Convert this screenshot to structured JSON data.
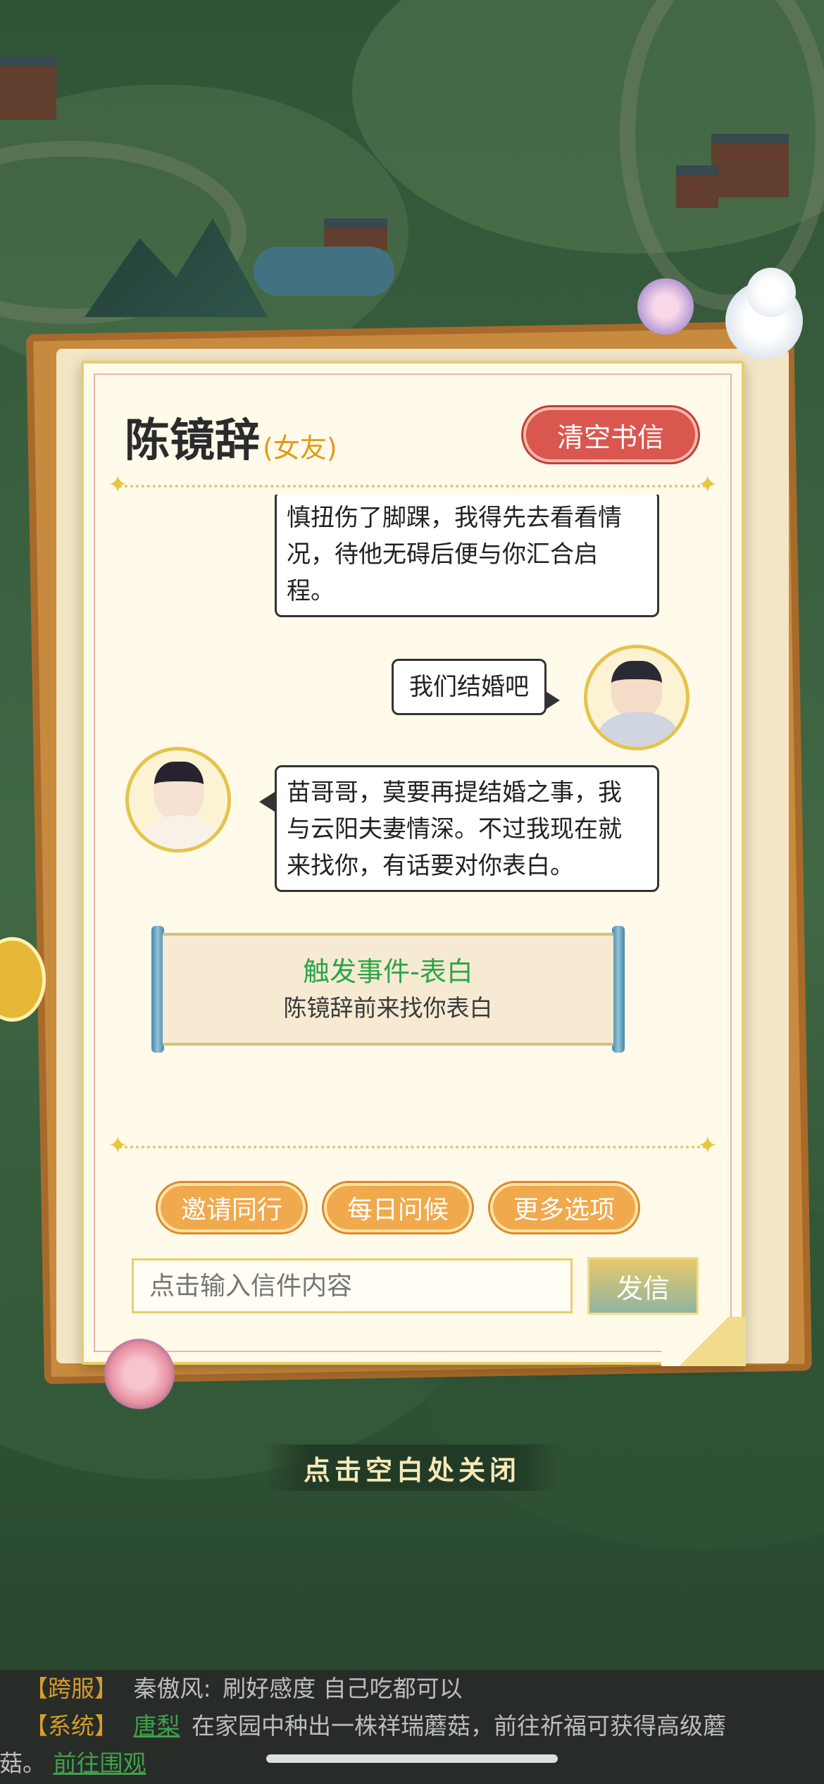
{
  "letter": {
    "name": "陈镜辞",
    "relation": "(女友)",
    "clear_label": "清空书信",
    "messages": [
      {
        "from": "her",
        "lines": [
          "慎扭伤了脚踝，我得先去看看情",
          "况，待他无碍后便与你汇合启",
          "程。"
        ]
      },
      {
        "from": "me",
        "lines": [
          "我们结婚吧"
        ]
      },
      {
        "from": "her",
        "lines": [
          "苗哥哥，莫要再提结婚之事，我",
          "与云阳夫妻情深。不过我现在就",
          "来找你，有话要对你表白。"
        ]
      }
    ],
    "event": {
      "title": "触发事件-表白",
      "desc": "陈镜辞前来找你表白"
    },
    "options": [
      "邀请同行",
      "每日问候",
      "更多选项"
    ],
    "input_placeholder": "点击输入信件内容",
    "send_label": "发信"
  },
  "close_hint": "点击空白处关闭",
  "broadcast": {
    "line1": {
      "tag": "【跨服】",
      "sender": "秦傲风:",
      "text": "刷好感度 自己吃都可以"
    },
    "line2": {
      "tag": "【系统】",
      "player": "唐梨",
      "text": "在家园中种出一株祥瑞蘑菇，前往祈福可获得高级蘑",
      "text2": "菇。",
      "link": "前往围观"
    }
  },
  "colors": {
    "accent_red": "#d9574f",
    "accent_orange": "#f0a94c",
    "event_green": "#2aa54a",
    "gold": "#e6cf6a"
  }
}
